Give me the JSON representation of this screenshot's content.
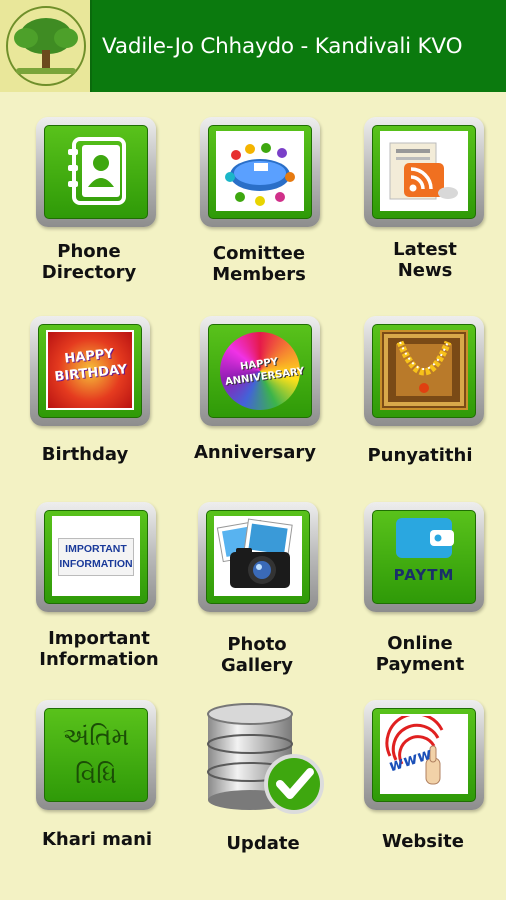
{
  "header": {
    "title": "Vadile-Jo Chhaydo - Kandivali KVO"
  },
  "grid": {
    "items": [
      {
        "label": "Phone\nDirectory",
        "icon": "address-book-icon"
      },
      {
        "label": "Comittee\nMembers",
        "icon": "meeting-table-icon"
      },
      {
        "label": "Latest\nNews",
        "icon": "rss-news-icon"
      },
      {
        "label": "Birthday",
        "icon": "happy-birthday-icon"
      },
      {
        "label": "Anniversary",
        "icon": "happy-anniversary-icon"
      },
      {
        "label": "Punyatithi",
        "icon": "garland-frame-icon"
      },
      {
        "label": "Important\nInformation",
        "icon": "important-information-icon"
      },
      {
        "label": "Photo\nGallery",
        "icon": "camera-photos-icon"
      },
      {
        "label": "Online\nPayment",
        "icon": "paytm-wallet-icon"
      },
      {
        "label": "Khari mani",
        "icon": "antim-vidhi-icon"
      },
      {
        "label": "Update",
        "icon": "database-check-icon"
      },
      {
        "label": "Website",
        "icon": "www-pointer-icon"
      }
    ],
    "image_text": {
      "birthday": "HAPPY BIRTHDAY",
      "anniversary": "HAPPY ANNIVERSARY",
      "important": "IMPORTANT INFORMATION",
      "paytm": "PAYTM",
      "antim": "અંતિમ વિધિ",
      "www": "www"
    }
  },
  "colors": {
    "background": "#f3f2c4",
    "header": "#0b7a0e",
    "tile_green": "#3ea70f"
  }
}
